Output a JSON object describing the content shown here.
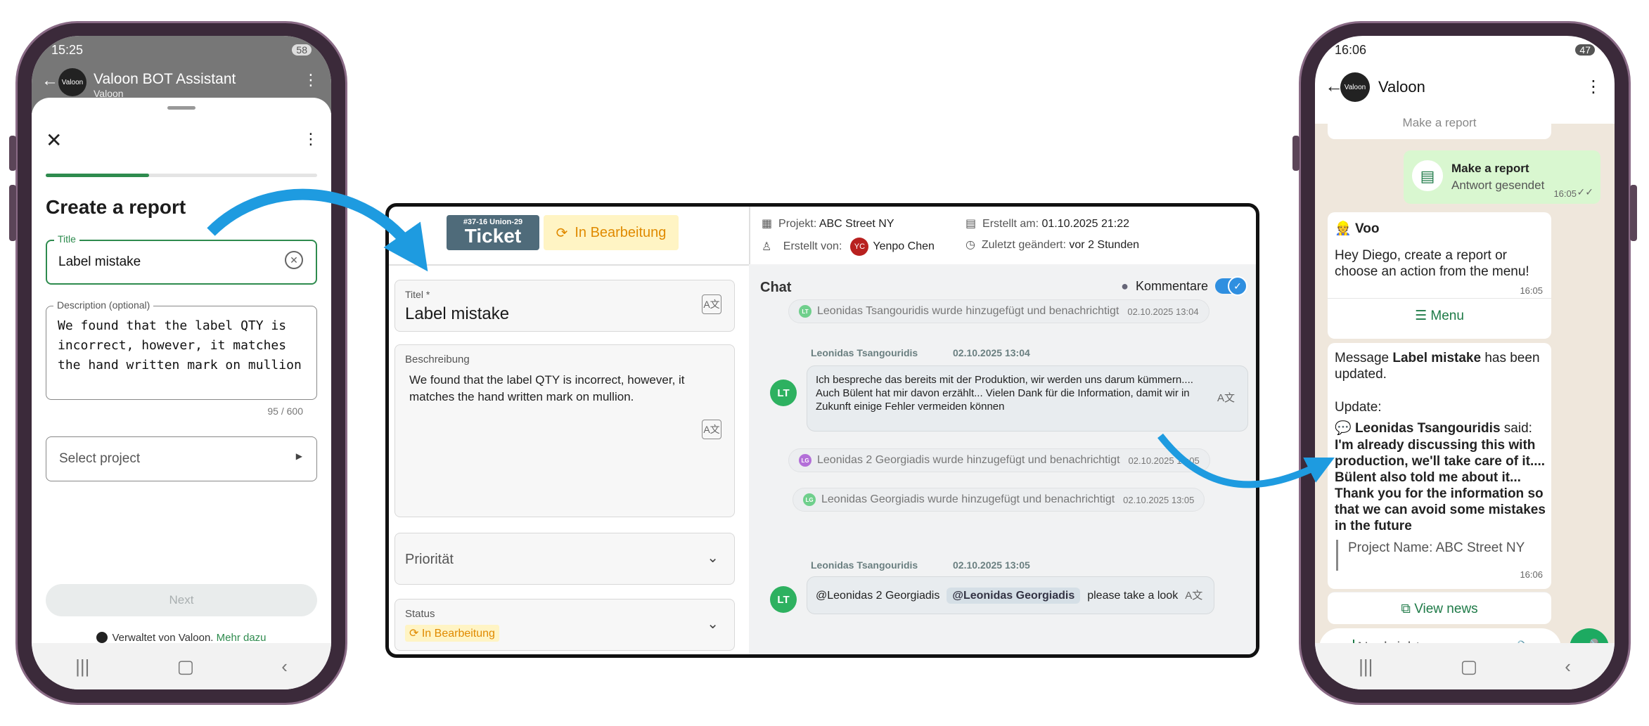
{
  "report_phone": {
    "status": {
      "time": "15:25",
      "battery": "58"
    },
    "header": {
      "title": "Valoon BOT Assistant",
      "subtitle": "Valoon"
    },
    "form": {
      "title": "Create a report",
      "title_label": "Title",
      "title_value": "Label mistake",
      "description_label": "Description (optional)",
      "description_value": "We found that the label QTY is incorrect, however, it matches the hand written mark on mullion",
      "char_count": "95 / 600",
      "project_placeholder": "Select project",
      "next_label": "Next",
      "footer_text": "Verwaltet von Valoon.",
      "footer_link": "Mehr dazu"
    }
  },
  "ticket": {
    "id": "#37-16 Union-29",
    "label": "Ticket",
    "status": "In Bearbeitung",
    "meta": {
      "project_label": "Projekt:",
      "project": "ABC Street NY",
      "created_by_label": "Erstellt von:",
      "created_by": "Yenpo Chen",
      "created_by_initials": "YC",
      "created_label": "Erstellt am:",
      "created": "01.10.2025 21:22",
      "changed_label": "Zuletzt geändert:",
      "changed": "vor 2 Stunden"
    },
    "title_label": "Titel *",
    "title_value": "Label mistake",
    "description_label": "Beschreibung",
    "description_value": "We found that the label QTY is incorrect, however, it matches the hand written mark on mullion.",
    "priority_label": "Priorität",
    "status_label": "Status",
    "status_value": "In Bearbeitung",
    "chat": {
      "title": "Chat",
      "comments_label": "Kommentare",
      "sys1": {
        "initials": "LT",
        "text": "Leonidas Tsangouridis wurde hinzugefügt und benachrichtigt",
        "time": "02.10.2025 13:04"
      },
      "msg1": {
        "author": "Leonidas Tsangouridis",
        "time": "02.10.2025 13:04",
        "initials": "LT",
        "text": "Ich bespreche das bereits mit der Produktion, wir werden uns darum kümmern.... Auch Bülent hat mir davon erzählt... Vielen Dank für die Information, damit wir in Zukunft einige Fehler vermeiden können"
      },
      "sys2": {
        "initials": "LG",
        "text": "Leonidas 2 Georgiadis wurde hinzugefügt und benachrichtigt",
        "time": "02.10.2025 13:05"
      },
      "sys3": {
        "initials": "LG",
        "text": "Leonidas Georgiadis wurde hinzugefügt und benachrichtigt",
        "time": "02.10.2025 13:05"
      },
      "msg2": {
        "author": "Leonidas Tsangouridis",
        "time": "02.10.2025 13:05",
        "initials": "LT",
        "mention1": "@Leonidas 2 Georgiadis",
        "mention2": "@Leonidas Georgiadis",
        "text": "please take a look"
      }
    }
  },
  "whatsapp_phone": {
    "status": {
      "time": "16:06",
      "battery": "47"
    },
    "header": {
      "title": "Valoon"
    },
    "msg_top_partial": "Make a report",
    "sent": {
      "title": "Make a report",
      "subtitle": "Antwort gesendet",
      "time": "16:05"
    },
    "voo": {
      "name": "Voo",
      "text": "Hey Diego, create a report or choose an action from the menu!",
      "time": "16:05",
      "menu": "Menu"
    },
    "update": {
      "line1_pre": "Message ",
      "line1_bold": "Label mistake",
      "line1_post": " has been updated.",
      "update_label": "Update:",
      "author": "Leonidas Tsangouridis",
      "said": " said:",
      "body": "I'm already discussing this with production, we'll take care of it.... Bülent also told me about it... Thank you for the information so that we can avoid some mistakes in the future",
      "project": "Project Name: ABC Street NY",
      "time": "16:06",
      "view": "View news"
    },
    "input_placeholder": "Nachricht"
  },
  "colors": {
    "green": "#2e8b4e",
    "blue_arrow": "#1e9be0",
    "wa_green": "#1daa61",
    "status_bg": "#fff4c4",
    "status_fg": "#e08a00"
  }
}
